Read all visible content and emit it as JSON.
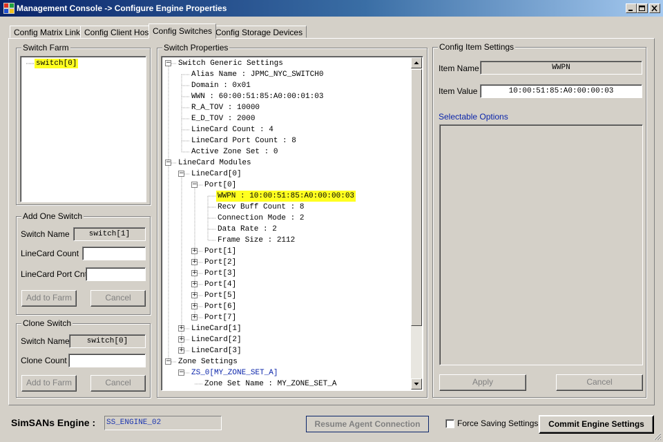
{
  "window": {
    "title": "Management Console -> Configure Engine Properties"
  },
  "tabs": [
    {
      "label": "Config Matrix Links"
    },
    {
      "label": "Config Client Hosts"
    },
    {
      "label": "Config Switches",
      "active": true
    },
    {
      "label": "Config Storage Devices"
    }
  ],
  "switch_farm": {
    "legend": "Switch Farm",
    "items": [
      "switch[0]"
    ]
  },
  "add_switch": {
    "legend": "Add One Switch",
    "name_label": "Switch Name",
    "name_value": "switch[1]",
    "count_label": "LineCard Count",
    "count_value": "",
    "port_label": "LineCard Port Cnt",
    "port_value": "",
    "add_label": "Add to Farm",
    "cancel_label": "Cancel"
  },
  "clone_switch": {
    "legend": "Clone Switch",
    "name_label": "Switch Name",
    "name_value": "switch[0]",
    "count_label": "Clone Count",
    "count_value": "",
    "add_label": "Add to Farm",
    "cancel_label": "Cancel"
  },
  "switch_properties": {
    "legend": "Switch Properties",
    "tree": [
      {
        "text": "Switch Generic Settings",
        "level": 0,
        "expander": "minus"
      },
      {
        "text": "Alias Name : JPMC_NYC_SWITCH0",
        "level": 1
      },
      {
        "text": "Domain : 0x01",
        "level": 1
      },
      {
        "text": "WWN : 60:00:51:85:A0:00:01:03",
        "level": 1
      },
      {
        "text": "R_A_TOV : 10000",
        "level": 1
      },
      {
        "text": "E_D_TOV : 2000",
        "level": 1
      },
      {
        "text": "LineCard Count : 4",
        "level": 1
      },
      {
        "text": "LineCard Port Count : 8",
        "level": 1
      },
      {
        "text": "Active Zone Set : 0",
        "level": 1
      },
      {
        "text": "LineCard Modules",
        "level": 0,
        "expander": "minus"
      },
      {
        "text": "LineCard[0]",
        "level": 1,
        "expander": "minus"
      },
      {
        "text": "Port[0]",
        "level": 2,
        "expander": "minus"
      },
      {
        "text": "WWPN : 10:00:51:85:A0:00:00:03",
        "level": 3,
        "selected": true
      },
      {
        "text": "Recv Buff Count : 8",
        "level": 3
      },
      {
        "text": "Connection Mode : 2",
        "level": 3
      },
      {
        "text": "Data Rate : 2",
        "level": 3
      },
      {
        "text": "Frame Size : 2112",
        "level": 3
      },
      {
        "text": "Port[1]",
        "level": 2,
        "expander": "plus"
      },
      {
        "text": "Port[2]",
        "level": 2,
        "expander": "plus"
      },
      {
        "text": "Port[3]",
        "level": 2,
        "expander": "plus"
      },
      {
        "text": "Port[4]",
        "level": 2,
        "expander": "plus"
      },
      {
        "text": "Port[5]",
        "level": 2,
        "expander": "plus"
      },
      {
        "text": "Port[6]",
        "level": 2,
        "expander": "plus"
      },
      {
        "text": "Port[7]",
        "level": 2,
        "expander": "plus"
      },
      {
        "text": "LineCard[1]",
        "level": 1,
        "expander": "plus"
      },
      {
        "text": "LineCard[2]",
        "level": 1,
        "expander": "plus"
      },
      {
        "text": "LineCard[3]",
        "level": 1,
        "expander": "plus"
      },
      {
        "text": "Zone Settings",
        "level": 0,
        "expander": "minus"
      },
      {
        "text": "ZS_0[MY_ZONE_SET_A]",
        "level": 1,
        "expander": "minus",
        "blue": true
      },
      {
        "text": "Zone Set Name : MY_ZONE_SET_A",
        "level": 2
      }
    ]
  },
  "config_item": {
    "legend": "Config Item Settings",
    "name_label": "Item Name",
    "name_value": "WWPN",
    "value_label": "Item Value",
    "value_value": "10:00:51:85:A0:00:00:03",
    "options_label": "Selectable Options",
    "apply_label": "Apply",
    "cancel_label": "Cancel"
  },
  "footer": {
    "engine_label": "SimSANs Engine :",
    "engine_value": "SS_ENGINE_02",
    "resume_label": "Resume Agent Connection",
    "force_label": "Force Saving Settings",
    "commit_label": "Commit Engine Settings"
  },
  "colors": {
    "titlebar": "#0a246a",
    "highlight": "#ffff20",
    "face": "#d4d0c8",
    "link": "#1c36b0"
  }
}
